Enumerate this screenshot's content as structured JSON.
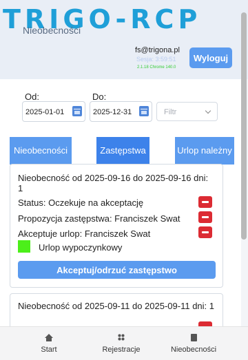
{
  "header": {
    "logo": "TRIGO-RCP",
    "subtitle": "Nieobecności",
    "user_email": "fs@trigona.pl",
    "session": "Sesja: 3:59:51",
    "version": "2.1.18 Chrome 140.0",
    "logout_label": "Wyloguj"
  },
  "filters": {
    "from_label": "Od:",
    "from_value": "2025-01-01",
    "to_label": "Do:",
    "to_value": "2025-12-31",
    "filter_placeholder": "Filtr"
  },
  "tabs": [
    {
      "label": "Nieobecności",
      "active": false
    },
    {
      "label": "Zastępstwa",
      "active": true
    },
    {
      "label": "Urlop należny",
      "active": false
    }
  ],
  "cards": [
    {
      "title": "Nieobecność od 2025-09-16 do 2025-09-16 dni: 1",
      "status": "Status: Oczekuje na akceptację",
      "proposal": "Propozycja zastępstwa: Franciszek Swat",
      "accepts": "Akceptuje urlop: Franciszek Swat",
      "leave_type": "Urlop wypoczynkowy",
      "leave_color": "#4cef1a",
      "action_label": "Akceptuj/odrzuć zastępstwo"
    },
    {
      "title": "Nieobecność od 2025-09-11 do 2025-09-11 dni: 1"
    }
  ],
  "bottom_nav": [
    {
      "label": "Start",
      "icon": "home-icon"
    },
    {
      "label": "Rejestracje",
      "icon": "grid-icon"
    },
    {
      "label": "Nieobecności",
      "icon": "document-icon"
    }
  ],
  "colors": {
    "primary": "#5b9bef",
    "active_tab": "#3d82ea",
    "danger": "#dc2b33",
    "logo": "#1f9fd8"
  }
}
